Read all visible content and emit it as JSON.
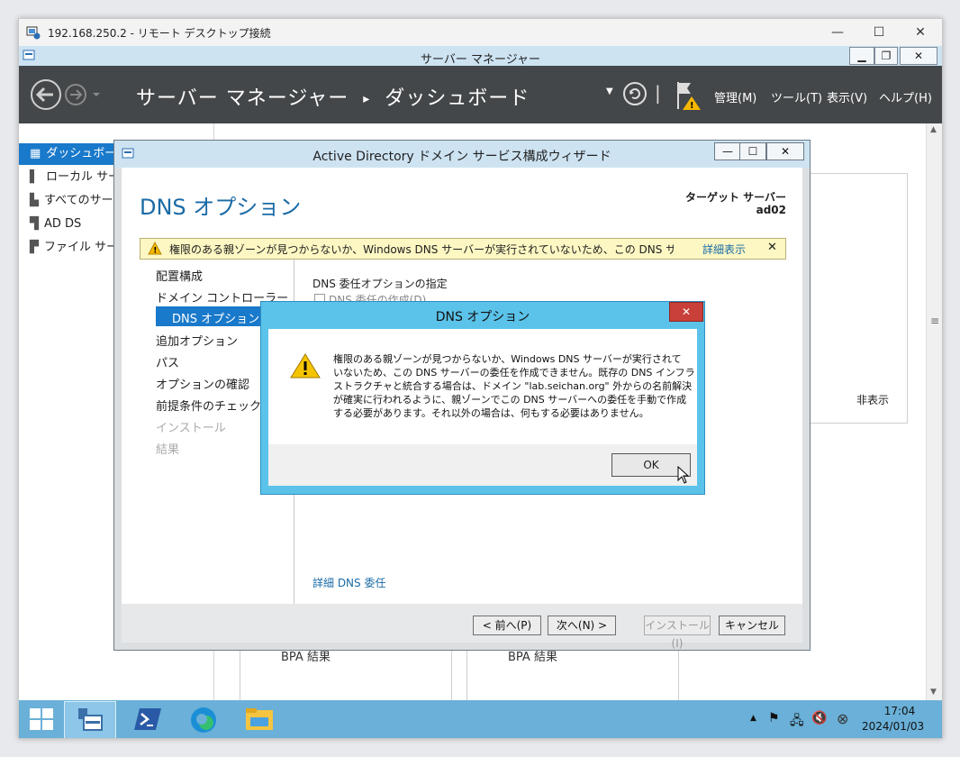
{
  "rdp": {
    "title": "192.168.250.2 - リモート デスクトップ接続"
  },
  "server_manager": {
    "title": "サーバー マネージャー",
    "breadcrumb_app": "サーバー マネージャー",
    "breadcrumb_sep": "▸",
    "breadcrumb_page": "ダッシュボード",
    "menus": [
      "管理(M)",
      "ツール(T)",
      "表示(V)",
      "ヘルプ(H)"
    ],
    "sidebar": [
      {
        "label": "ダッシュボード",
        "icon": "dashboard-icon"
      },
      {
        "label": "ローカル サーバー",
        "icon": "server-icon"
      },
      {
        "label": "すべてのサーバー",
        "icon": "servers-icon"
      },
      {
        "label": "AD DS",
        "icon": "adds-icon"
      },
      {
        "label": "ファイル サービス",
        "icon": "file-services-icon"
      }
    ],
    "hide_label": "非表示",
    "bpa_labels": [
      "BPA 結果",
      "BPA 結果"
    ]
  },
  "wizard": {
    "title": "Active Directory ドメイン サービス構成ウィザード",
    "heading": "DNS オプション",
    "target_label": "ターゲット サーバー",
    "target_value": "ad02",
    "warning_text": "権限のある親ゾーンが見つからないか、Windows DNS サーバーが実行されていないため、この DNS サーバーの委任を作…",
    "details_link": "詳細表示",
    "nav": [
      "配置構成",
      "ドメイン コントローラー オプ…",
      "DNS オプション",
      "追加オプション",
      "パス",
      "オプションの確認",
      "前提条件のチェック",
      "インストール",
      "結果"
    ],
    "section_title": "DNS 委任オプションの指定",
    "checkbox_label": "DNS 委任の作成(D)",
    "more_link": "詳細 DNS 委任",
    "buttons": {
      "prev": "< 前へ(P)",
      "next": "次へ(N) >",
      "install": "インストール(I)",
      "cancel": "キャンセル"
    }
  },
  "dialog": {
    "title": "DNS オプション",
    "message_lines": [
      "権限のある親ゾーンが見つからないか、Windows DNS サーバーが実行されて",
      "いないため、この DNS サーバーの委任を作成できません。既存の DNS インフラ",
      "ストラクチャと統合する場合は、ドメイン \"lab.seichan.org\" 外からの名前解決",
      "が確実に行われるように、親ゾーンでこの DNS サーバーへの委任を手動で作成",
      "する必要があります。それ以外の場合は、何もする必要はありません。"
    ],
    "ok_label": "OK"
  },
  "taskbar": {
    "time": "17:04",
    "date": "2024/01/03"
  },
  "colors": {
    "accent": "#1979ca",
    "header_bg": "#444749",
    "dialog_frame": "#5bc3ea",
    "warning_bg": "#fdf7c3"
  }
}
